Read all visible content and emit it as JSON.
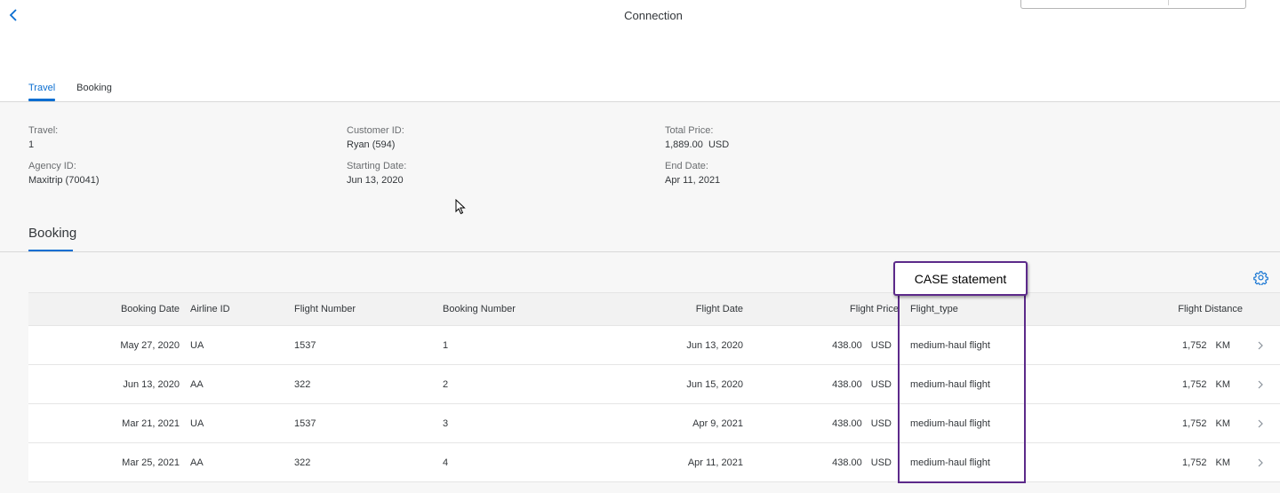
{
  "header": {
    "title": "Connection",
    "back_icon": "chevron-left-icon"
  },
  "tabs": [
    {
      "label": "Travel",
      "active": true
    },
    {
      "label": "Booking",
      "active": false
    }
  ],
  "travel": {
    "travel_label": "Travel:",
    "travel_value": "1",
    "customer_label": "Customer ID:",
    "customer_value": "Ryan (594)",
    "total_price_label": "Total Price:",
    "total_price_value": "1,889.00",
    "total_price_currency": "USD",
    "agency_label": "Agency ID:",
    "agency_value": "Maxitrip (70041)",
    "starting_date_label": "Starting Date:",
    "starting_date_value": "Jun 13, 2020",
    "end_date_label": "End Date:",
    "end_date_value": "Apr 11, 2021"
  },
  "booking_section": {
    "title": "Booking",
    "settings_icon": "gear-icon",
    "columns": [
      "Booking Date",
      "Airline ID",
      "Flight Number",
      "Booking Number",
      "Flight Date",
      "Flight Price",
      "Flight_type",
      "Flight Distance"
    ],
    "rows": [
      {
        "booking_date": "May 27, 2020",
        "airline_id": "UA",
        "flight_number": "1537",
        "booking_number": "1",
        "flight_date": "Jun 13, 2020",
        "price": "438.00",
        "currency": "USD",
        "flight_type": "medium-haul flight",
        "distance": "1,752",
        "distance_unit": "KM"
      },
      {
        "booking_date": "Jun 13, 2020",
        "airline_id": "AA",
        "flight_number": "322",
        "booking_number": "2",
        "flight_date": "Jun 15, 2020",
        "price": "438.00",
        "currency": "USD",
        "flight_type": "medium-haul flight",
        "distance": "1,752",
        "distance_unit": "KM"
      },
      {
        "booking_date": "Mar 21, 2021",
        "airline_id": "UA",
        "flight_number": "1537",
        "booking_number": "3",
        "flight_date": "Apr 9, 2021",
        "price": "438.00",
        "currency": "USD",
        "flight_type": "medium-haul flight",
        "distance": "1,752",
        "distance_unit": "KM"
      },
      {
        "booking_date": "Mar 25, 2021",
        "airline_id": "AA",
        "flight_number": "322",
        "booking_number": "4",
        "flight_date": "Apr 11, 2021",
        "price": "438.00",
        "currency": "USD",
        "flight_type": "medium-haul flight",
        "distance": "1,752",
        "distance_unit": "KM"
      }
    ]
  },
  "annotation": {
    "label": "CASE statement",
    "color": "#5c2a8a"
  },
  "colors": {
    "accent": "#0a6ed1",
    "text": "#32363a",
    "label": "#6a6d70"
  }
}
